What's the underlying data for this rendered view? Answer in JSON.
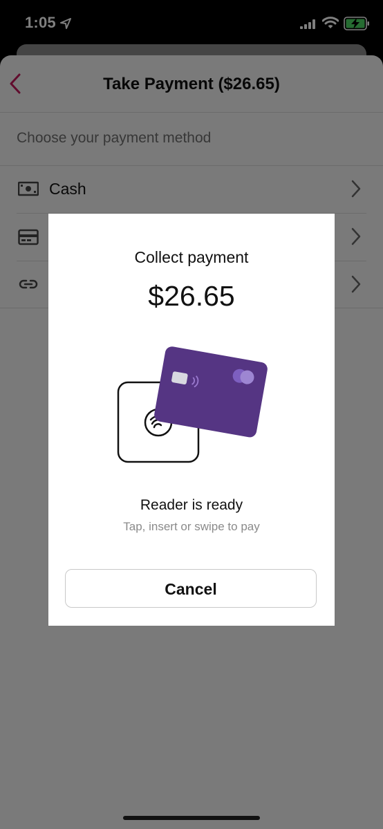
{
  "status_bar": {
    "time": "1:05",
    "icons": [
      "location-arrow-icon",
      "cellular-signal-icon",
      "wifi-icon",
      "battery-charging-icon"
    ]
  },
  "header": {
    "title": "Take Payment ($26.65)",
    "back_icon": "chevron-left-icon",
    "accent_color": "#c2185b"
  },
  "payment_methods": {
    "section_label": "Choose your payment method",
    "items": [
      {
        "label": "Cash",
        "icon": "cash-icon"
      },
      {
        "label": "",
        "icon": "credit-card-icon"
      },
      {
        "label": "",
        "icon": "link-icon"
      }
    ]
  },
  "modal": {
    "title": "Collect payment",
    "amount": "$26.65",
    "status": "Reader is ready",
    "hint": "Tap, insert or swipe to pay",
    "cancel_label": "Cancel",
    "card_color": "#553583"
  }
}
